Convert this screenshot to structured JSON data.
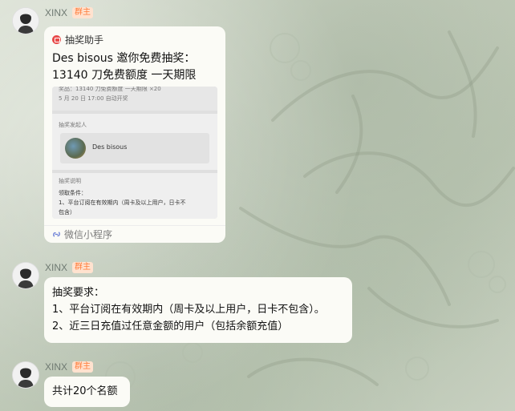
{
  "messages": [
    {
      "sender": "XINX",
      "badge": "群主",
      "card": {
        "app_name": "抽奖助手",
        "title": "Des bisous 邀你免费抽奖：13140 刀免费额度 一天期限",
        "thumb": {
          "line1": "奖品：13140 刀免费额度 一天期限 ×20",
          "line2": "5 月 20 日 17:00 自动开奖",
          "host_label": "抽奖发起人",
          "host_name": "Des bisous",
          "desc_label": "抽奖说明",
          "desc_line1": "领取条件：",
          "desc_line2": "1、平台订阅在有效期内（周卡及以上用户，日卡不",
          "desc_line3": "包含）"
        },
        "footer": "微信小程序"
      }
    },
    {
      "sender": "XINX",
      "badge": "群主",
      "lines": [
        "抽奖要求：",
        "1、平台订阅在有效期内（周卡及以上用户，日卡不包含）。",
        "2、近三日充值过任意金额的用户（包括余额充值）"
      ]
    },
    {
      "sender": "XINX",
      "badge": "群主",
      "text": "共计20个名额"
    }
  ]
}
